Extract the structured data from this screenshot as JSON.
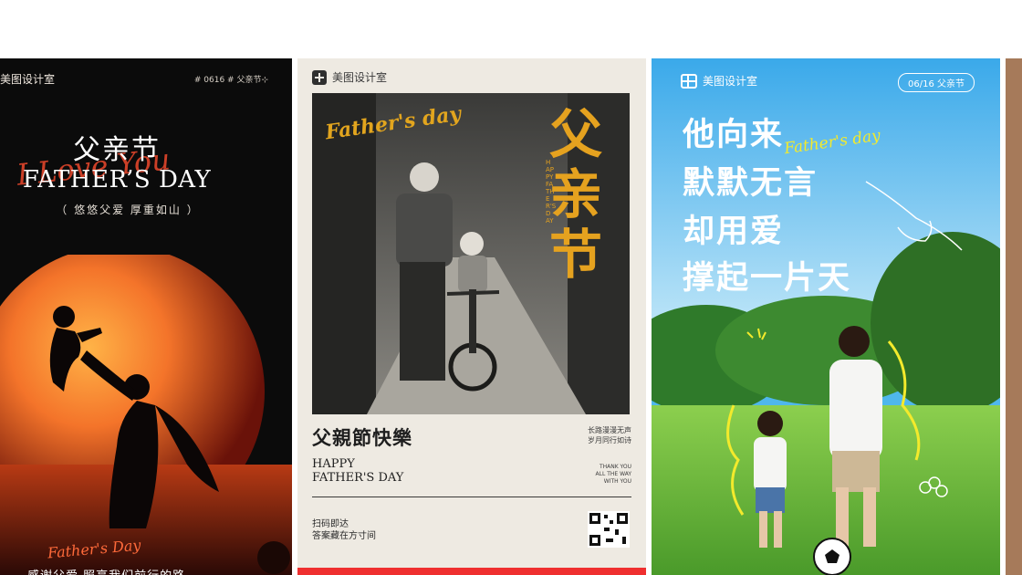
{
  "cards": [
    {
      "brand": "美图设计室",
      "tag": "# 0616 # 父亲节⊹",
      "title_cn": "父亲节",
      "script": "I Love You",
      "title_en": "FATHER’S DAY",
      "subtitle": "（ 悠悠父爱  厚重如山 ）",
      "bottom_script": "Father's Day",
      "bottom_text": "感谢父爱   照亮我们前行的路"
    },
    {
      "brand": "美图设计室",
      "script": "Father's day",
      "big_title": "父亲节",
      "tiny_vertical": "HAPPY FATHER'S DAY",
      "heading_cn": "父親節快樂",
      "heading_en_1": "HAPPY",
      "heading_en_2": "FATHER'S DAY",
      "right_text_1": "长路漫漫无声",
      "right_text_2": "岁月同行如诗",
      "right_small_1": "THANK YOU",
      "right_small_2": "ALL THE WAY",
      "right_small_3": "WITH YOU",
      "scan_1": "扫码即达",
      "scan_2": "答案藏在方寸间"
    },
    {
      "brand": "美图设计室",
      "tag": "06/16  父亲节",
      "line_1": "他向来",
      "line_2": "默默无言",
      "line_3": "却用爱",
      "line_4": "撑起一片天",
      "script": "Father's day"
    }
  ],
  "colors": {
    "accent_red": "#e0452b",
    "gold": "#e5a21f",
    "sky": "#4fb7ec",
    "grass": "#6fbf3c",
    "highlight_yellow": "#f3ea2c",
    "red_bar": "#ef2f2f"
  }
}
